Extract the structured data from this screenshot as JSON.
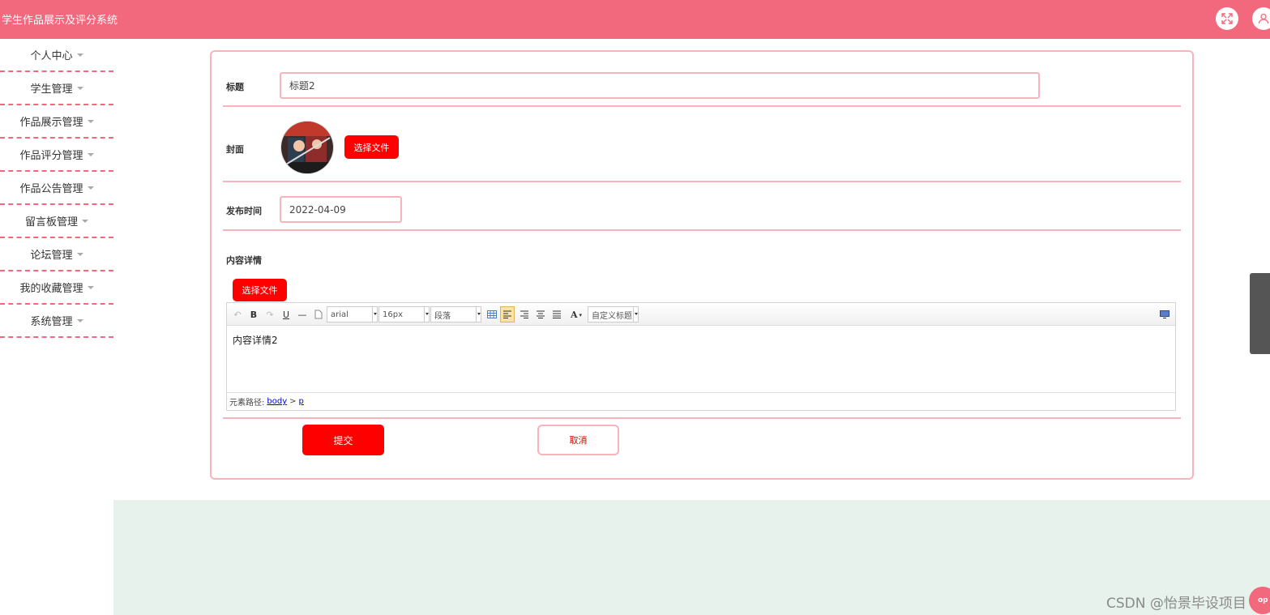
{
  "app": {
    "title": "学生作品展示及评分系统"
  },
  "header": {
    "fullscreen_icon": "expand-icon",
    "user_icon": "user-icon"
  },
  "sidebar": {
    "items": [
      {
        "label": "个人中心"
      },
      {
        "label": "学生管理"
      },
      {
        "label": "作品展示管理"
      },
      {
        "label": "作品评分管理"
      },
      {
        "label": "作品公告管理"
      },
      {
        "label": "留言板管理"
      },
      {
        "label": "论坛管理"
      },
      {
        "label": "我的收藏管理"
      },
      {
        "label": "系统管理"
      }
    ]
  },
  "form": {
    "title_label": "标题",
    "title_value": "标题2",
    "cover_label": "封面",
    "cover_button": "选择文件",
    "date_label": "发布时间",
    "date_value": "2022-04-09",
    "content_label": "内容详情",
    "content_button": "选择文件",
    "submit_label": "提交",
    "cancel_label": "取消"
  },
  "editor": {
    "font_family": "arial",
    "font_size": "16px",
    "paragraph": "段落",
    "custom_title": "自定义标题",
    "body_text": "内容详情2",
    "path_label": "元素路径:",
    "path_body": "body",
    "path_sep": ">",
    "path_p": "p",
    "bold": "B",
    "underline": "U",
    "font_color": "A"
  },
  "watermark": "CSDN @怡景毕设项目",
  "back_to_top": "op",
  "colors": {
    "primary": "#f2687d",
    "button_red": "#ff0000",
    "border_pink": "#f9b3bc",
    "footer": "#e8f2ed"
  }
}
